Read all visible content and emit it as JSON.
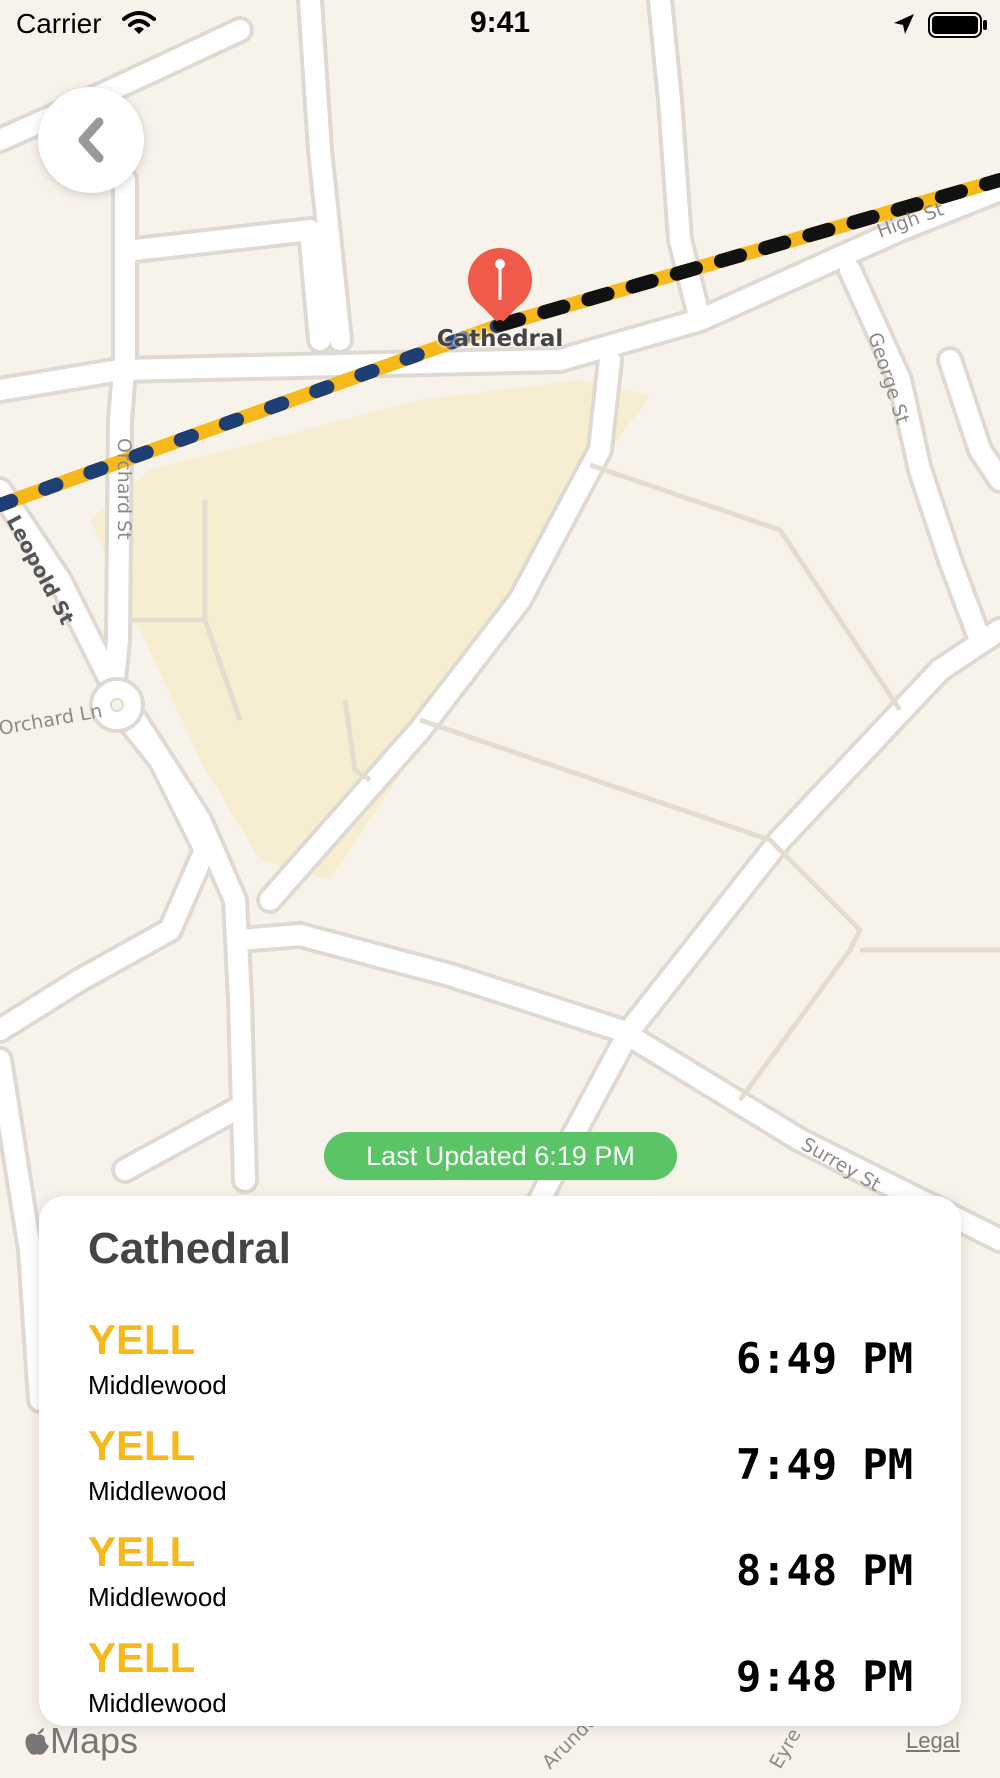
{
  "status_bar": {
    "carrier": "Carrier",
    "time": "9:41"
  },
  "map": {
    "street_labels": [
      "High St",
      "George St",
      "Orchard St",
      "Leopold St",
      "Orchard Ln",
      "Surrey St",
      "Arunde",
      "Eyre"
    ],
    "stop_label": "Cathedral",
    "colors": {
      "route_primary": "#f6b81a",
      "route_secondary_a": "#1d3f74",
      "route_secondary_b": "#111111",
      "pin": "#f05a4a",
      "park": "#f7edd0"
    }
  },
  "last_updated": "Last Updated 6:19 PM",
  "card": {
    "title": "Cathedral",
    "departures": [
      {
        "route": "YELL",
        "destination": "Middlewood",
        "time": "6:49 PM"
      },
      {
        "route": "YELL",
        "destination": "Middlewood",
        "time": "7:49 PM"
      },
      {
        "route": "YELL",
        "destination": "Middlewood",
        "time": "8:48 PM"
      },
      {
        "route": "YELL",
        "destination": "Middlewood",
        "time": "9:48 PM"
      }
    ]
  },
  "footer": {
    "maps_logo": "Maps",
    "legal": "Legal"
  },
  "icons": [
    "wifi-icon",
    "location-arrow-icon",
    "battery-icon",
    "chevron-left-icon",
    "map-pin-icon",
    "apple-logo-icon"
  ]
}
